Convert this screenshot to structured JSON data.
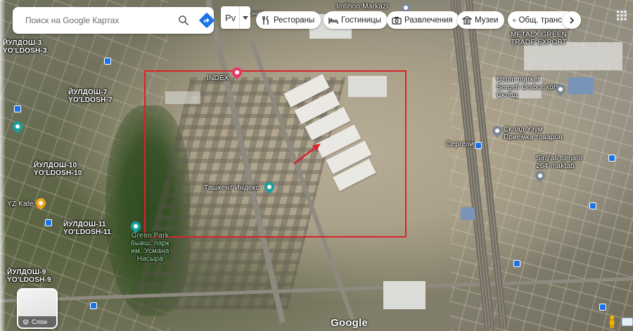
{
  "search": {
    "placeholder": "Поиск на Google Картах"
  },
  "filter": {
    "label": "Рv"
  },
  "chips": [
    {
      "label": "Рестораны",
      "icon": "fork-knife-icon"
    },
    {
      "label": "Гостиницы",
      "icon": "bed-icon"
    },
    {
      "label": "Развлечения",
      "icon": "camera-icon"
    },
    {
      "label": "Музеи",
      "icon": "museum-icon"
    },
    {
      "label": "Общ. транс",
      "icon": "bus-icon"
    }
  ],
  "map_labels": {
    "neighborhood_3": "ЙУЛДОШ-3\nYO'LDOSH-3",
    "neighborhood_7": "ЙУЛДОШ-7\nYO'LDOSH-7",
    "neighborhood_10": "ЙУЛДОШ-10\nYO'LDOSH-10",
    "neighborhood_11": "ЙУЛДОШ-11\nYO'LDOSH-11",
    "neighborhood_9": "ЙУЛДОШ-9\nYO'LDOSH-9",
    "index": "INDEX",
    "tashkent_index": "Ташкент Индекс",
    "green_park": "Green Park\nбывш. парк\nим. Усмана\nНасыра",
    "yz_kafe": "YZ Kafe",
    "metal_export": "METALX GREEN\nTRADE EXPORT",
    "uzum_market": "Uzum market\nSergeli Ombor xona\nСклад",
    "sklad_uzum": "Склад Узум\nПриемка товаров",
    "sergeli": "Сергели",
    "school": "Sirg'ali tumani\n264-maktab",
    "imtihon": "Imtihon Markazi",
    "top_snippet": "онар"
  },
  "layers": {
    "label": "Слои"
  },
  "logo": {
    "text": "Google"
  },
  "colors": {
    "highlight": "#d8232a",
    "accent": "#1a73e8"
  }
}
